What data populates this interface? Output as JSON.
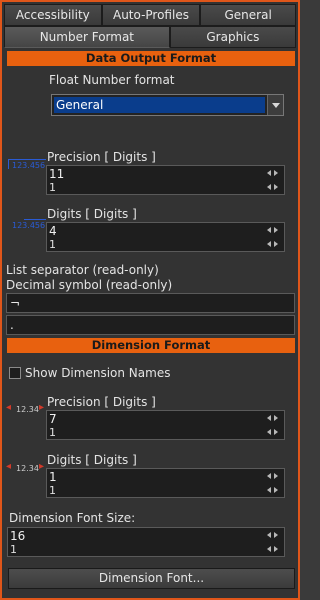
{
  "tabs_row1": [
    "Accessibility",
    "Auto-Profiles",
    "General"
  ],
  "tabs_row2": [
    "Number Format",
    "Graphics"
  ],
  "active_tab": "Number Format",
  "data_output": {
    "header": "Data Output Format",
    "float_label": "Float Number format",
    "float_value": "General",
    "precision": {
      "label": "Precision [ Digits ]",
      "value": "11",
      "sub": "1",
      "icon_text": "123.456"
    },
    "digits": {
      "label": "Digits [ Digits ]",
      "value": "4",
      "sub": "1",
      "icon_text": "123.456"
    },
    "list_sep_label": "List separator (read-only)",
    "decimal_label": "Decimal symbol (read-only)",
    "list_sep_value": "¬",
    "decimal_value": "."
  },
  "dimension": {
    "header": "Dimension Format",
    "show_names_label": "Show Dimension Names",
    "precision": {
      "label": "Precision [ Digits ]",
      "value": "7",
      "sub": "1",
      "icon_text": "12.34"
    },
    "digits": {
      "label": "Digits [ Digits ]",
      "value": "1",
      "sub": "1",
      "icon_text": "12.34"
    },
    "font_size_label": "Dimension Font Size:",
    "font_size_value": "16",
    "font_size_sub": "1",
    "font_button": "Dimension Font..."
  },
  "colors": {
    "accent": "#e8610f",
    "frame": "#e0561a",
    "selection": "#0a3d8c"
  }
}
